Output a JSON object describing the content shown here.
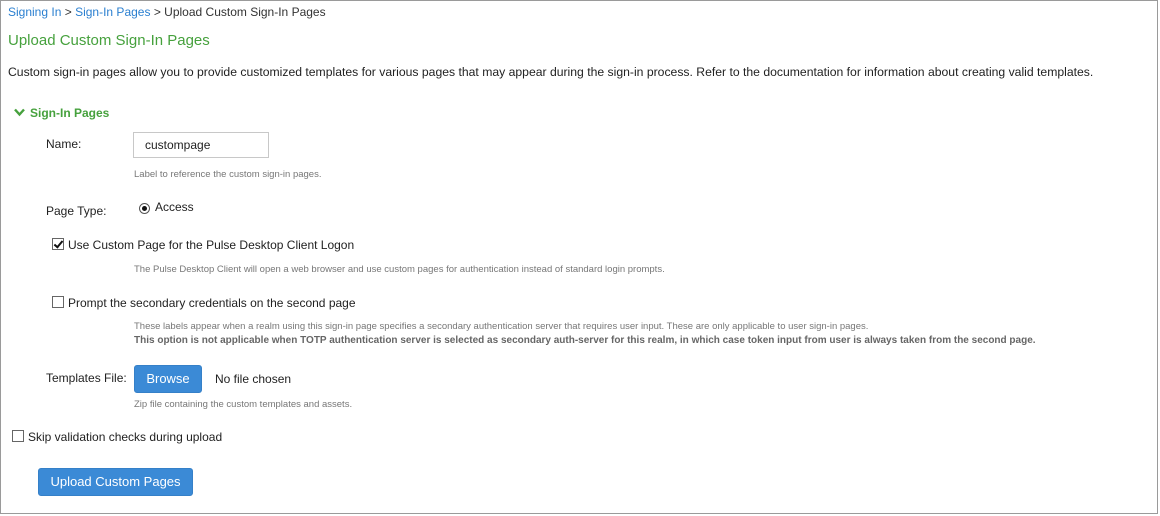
{
  "breadcrumb": {
    "items": [
      "Signing In",
      "Sign-In Pages"
    ],
    "separator": ">",
    "current": "Upload Custom Sign-In Pages"
  },
  "page": {
    "title": "Upload Custom Sign-In Pages",
    "description": "Custom sign-in pages allow you to provide customized templates for various pages that may appear during the sign-in process. Refer to the documentation for information about creating valid templates."
  },
  "section": {
    "title": "Sign-In Pages",
    "expanded": true
  },
  "form": {
    "name": {
      "label": "Name:",
      "value": "custompage",
      "help": "Label to reference the custom sign-in pages."
    },
    "page_type": {
      "label": "Page Type:",
      "option": "Access",
      "selected": true
    },
    "use_custom_page": {
      "label": "Use Custom Page for the Pulse Desktop Client Logon",
      "checked": true,
      "help": "The Pulse Desktop Client will open a web browser and use custom pages for authentication instead of standard login prompts."
    },
    "prompt_secondary": {
      "label": "Prompt the secondary credentials on the second page",
      "checked": false,
      "help": "These labels appear when a realm using this sign-in page specifies a secondary authentication server that requires user input. These are only applicable to user sign-in pages.",
      "help_bold": "This option is not applicable when TOTP authentication server is selected as secondary auth-server for this realm, in which case token input from user is always taken from the second page."
    },
    "templates_file": {
      "label": "Templates File:",
      "button": "Browse",
      "status": "No file chosen",
      "help": "Zip file containing the custom templates and assets."
    },
    "skip_validation": {
      "label": "Skip validation checks during upload",
      "checked": false
    }
  },
  "actions": {
    "upload_label": "Upload Custom Pages"
  },
  "colors": {
    "accent_green": "#46a13d",
    "link_blue": "#2a7fd0",
    "button_blue": "#3b8ad6"
  }
}
